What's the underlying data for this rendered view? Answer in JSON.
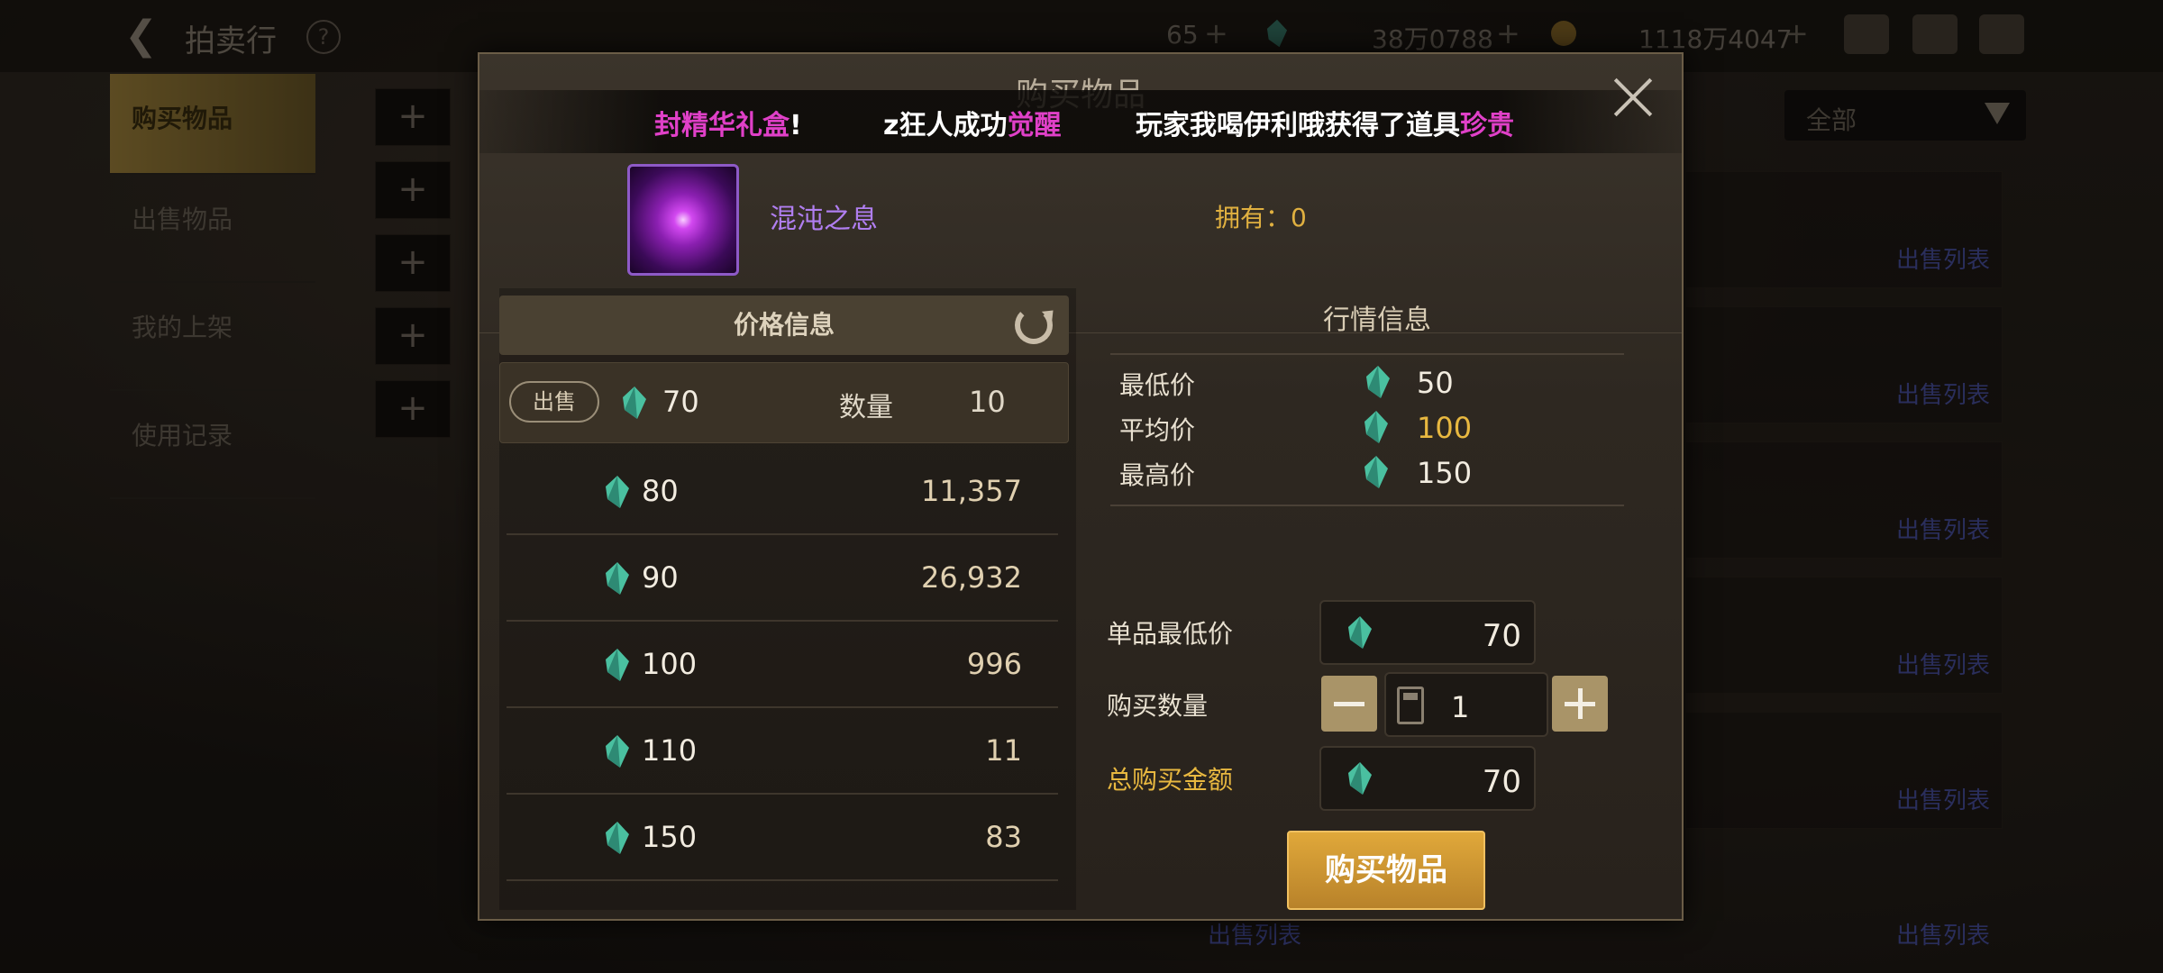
{
  "header": {
    "title": "拍卖行",
    "resources": [
      {
        "value": "65",
        "icon": "moon-token-icon"
      },
      {
        "value": "38万0788",
        "icon": "gem-icon"
      },
      {
        "value": "1118万4047",
        "icon": "gold-coin-icon"
      }
    ]
  },
  "sidebar": {
    "items": [
      {
        "label": "购买物品",
        "active": true
      },
      {
        "label": "出售物品"
      },
      {
        "label": "我的上架"
      },
      {
        "label": "使用记录"
      }
    ]
  },
  "filter": {
    "selected": "全部"
  },
  "background_links": {
    "sell_list": "出售列表"
  },
  "modal": {
    "title": "购买物品",
    "broadcast": [
      {
        "prefix": "",
        "highlight": "封精华礼盒",
        "suffix": "!"
      },
      {
        "prefix": "z狂人成功",
        "highlight": "觉醒",
        "suffix": ""
      },
      {
        "prefix": "玩家我喝伊利哦获得了道具",
        "highlight": "珍贵",
        "suffix": ""
      }
    ],
    "item": {
      "name": "混沌之息",
      "own_label": "拥有：",
      "own_count": "0"
    },
    "price_panel": {
      "title": "价格信息",
      "sell_row": {
        "badge": "出售",
        "price": "70",
        "qty_label": "数量",
        "qty": "10"
      },
      "orders": [
        {
          "price": "80",
          "qty": "11,357"
        },
        {
          "price": "90",
          "qty": "26,932"
        },
        {
          "price": "100",
          "qty": "996"
        },
        {
          "price": "110",
          "qty": "11"
        },
        {
          "price": "150",
          "qty": "83"
        }
      ]
    },
    "market": {
      "title": "行情信息",
      "rows": [
        {
          "label": "最低价",
          "value": "50"
        },
        {
          "label": "平均价",
          "value": "100"
        },
        {
          "label": "最高价",
          "value": "150"
        }
      ]
    },
    "form": {
      "unit_price_label": "单品最低价",
      "unit_price": "70",
      "qty_label": "购买数量",
      "qty": "1",
      "total_label": "总购买金额",
      "total": "70"
    },
    "buy_button": "购买物品"
  },
  "colors": {
    "accent_gold": "#e8b840",
    "item_purple": "#b07ef0",
    "broadcast_pink": "#e040c8",
    "button_gold": "#d69c34"
  }
}
